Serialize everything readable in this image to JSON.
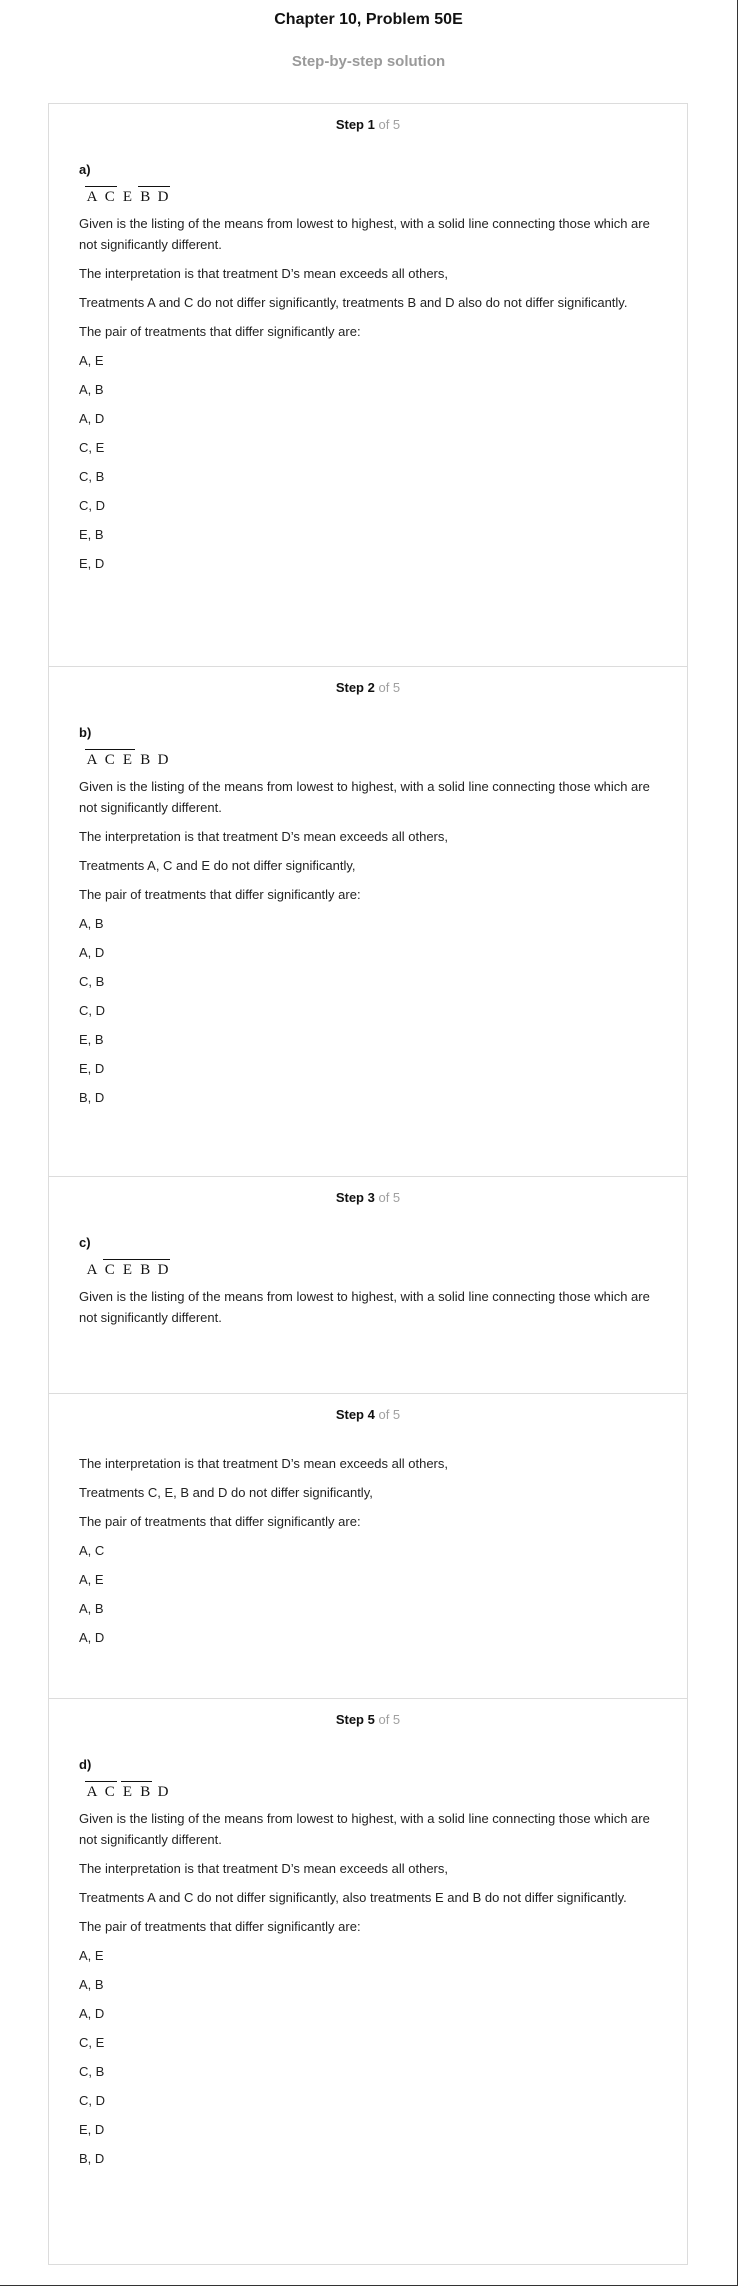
{
  "header": {
    "title": "Chapter 10, Problem 50E",
    "subtitle": "Step-by-step solution"
  },
  "steps": [
    {
      "label": "Step 1",
      "of": "of 5",
      "part": "a)",
      "means": [
        "A",
        "C",
        "E",
        "B",
        "D"
      ],
      "bars": [
        [
          0,
          1
        ],
        [
          3,
          4
        ]
      ],
      "lines": [
        "Given is the listing of the means from lowest to highest, with a solid line connecting those which are not significantly different.",
        "The interpretation is that treatment D’s mean exceeds all others,",
        "Treatments A and C do not differ significantly, treatments B and D also do not differ significantly.",
        "The pair of treatments that differ significantly are:"
      ],
      "pairs": [
        "A, E",
        "A, B",
        "A, D",
        "C, E",
        "C, B",
        "C, D",
        "E, B",
        "E, D"
      ]
    },
    {
      "label": "Step 2",
      "of": "of 5",
      "part": "b)",
      "means": [
        "A",
        "C",
        "E",
        "B",
        "D"
      ],
      "bars": [
        [
          0,
          2
        ]
      ],
      "lines": [
        "Given is the listing of the means from lowest to highest, with a solid line connecting those which are not significantly different.",
        "The interpretation is that treatment D’s mean exceeds all others,",
        "Treatments A, C and E do not differ significantly,",
        "The pair of treatments that differ significantly are:"
      ],
      "pairs": [
        "A, B",
        "A, D",
        "C, B",
        "C, D",
        "E, B",
        "E, D",
        "B, D"
      ]
    },
    {
      "label": "Step 3",
      "of": "of 5",
      "part": "c)",
      "means": [
        "A",
        "C",
        "E",
        "B",
        "D"
      ],
      "bars": [
        [
          1,
          4
        ]
      ],
      "lines": [
        "Given is the listing of the means from lowest to highest, with a solid line connecting those which are not significantly different."
      ],
      "pairs": []
    },
    {
      "label": "Step 4",
      "of": "of 5",
      "part": "",
      "means": [],
      "bars": [],
      "lines": [
        "The interpretation is that treatment D’s mean exceeds all others,",
        "Treatments C, E, B and D do not differ significantly,",
        "The pair of treatments that differ significantly are:"
      ],
      "pairs": [
        "A, C",
        "A, E",
        "A, B",
        "A, D"
      ]
    },
    {
      "label": "Step 5",
      "of": "of 5",
      "part": "d)",
      "means": [
        "A",
        "C",
        "E",
        "B",
        "D"
      ],
      "bars": [
        [
          0,
          1
        ],
        [
          2,
          3
        ]
      ],
      "lines": [
        "Given is the listing of the means from lowest to highest, with a solid line connecting those which are not significantly different.",
        "The interpretation is that treatment D’s mean exceeds all others,",
        "Treatments A and C do not differ significantly, also treatments E and B do not differ significantly.",
        "The pair of treatments that differ significantly are:"
      ],
      "pairs": [
        "A, E",
        "A, B",
        "A, D",
        "C, E",
        "C, B",
        "C, D",
        "E, D",
        "B, D"
      ]
    }
  ]
}
